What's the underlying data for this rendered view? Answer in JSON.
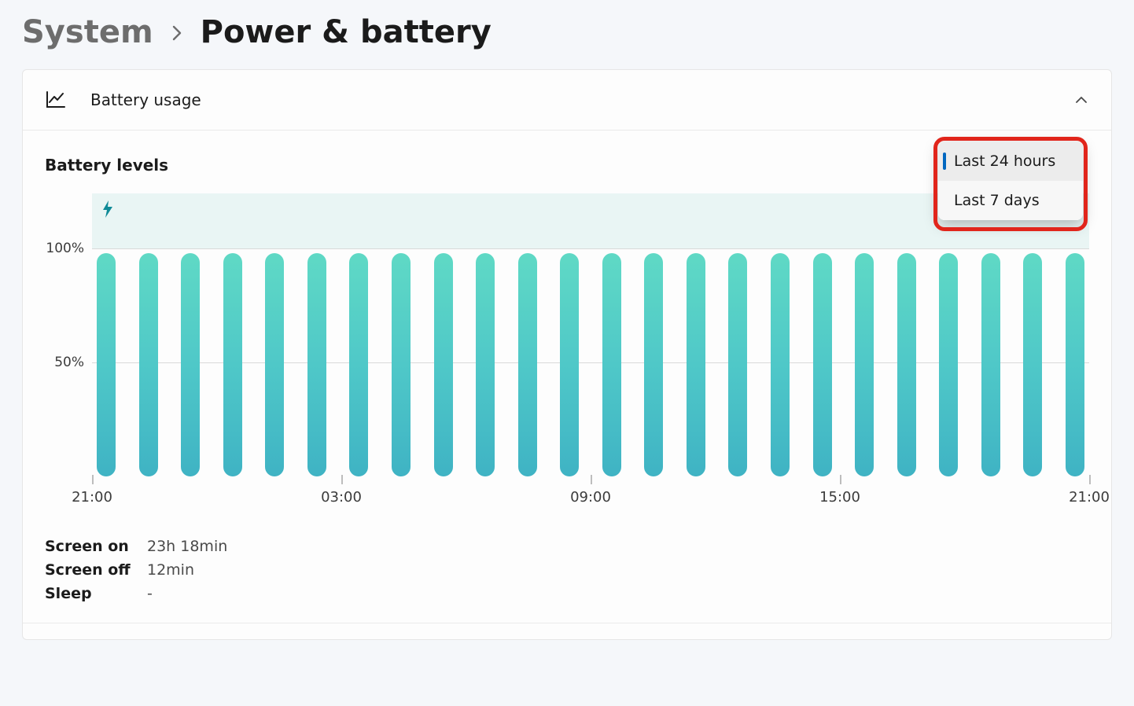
{
  "breadcrumb": {
    "parent": "System",
    "current": "Power & battery"
  },
  "card": {
    "header_title": "Battery usage",
    "section_title": "Battery levels"
  },
  "dropdown": {
    "options": [
      {
        "label": "Last 24 hours",
        "selected": true
      },
      {
        "label": "Last 7 days",
        "selected": false
      }
    ]
  },
  "summary": {
    "rows": [
      {
        "label": "Screen on",
        "value": "23h 18min"
      },
      {
        "label": "Screen off",
        "value": "12min"
      },
      {
        "label": "Sleep",
        "value": "-"
      }
    ]
  },
  "chart_data": {
    "type": "bar",
    "title": "Battery levels",
    "ylabel": "",
    "xlabel": "",
    "ylim": [
      0,
      100
    ],
    "y_ticks": [
      "100%",
      "50%"
    ],
    "x_ticks": [
      "21:00",
      "03:00",
      "09:00",
      "15:00",
      "21:00"
    ],
    "categories": [
      "21:00",
      "22:00",
      "23:00",
      "00:00",
      "01:00",
      "02:00",
      "03:00",
      "04:00",
      "05:00",
      "06:00",
      "07:00",
      "08:00",
      "09:00",
      "10:00",
      "11:00",
      "12:00",
      "13:00",
      "14:00",
      "15:00",
      "16:00",
      "17:00",
      "18:00",
      "19:00",
      "20:00"
    ],
    "values": [
      98,
      98,
      98,
      98,
      98,
      98,
      98,
      98,
      98,
      98,
      98,
      98,
      98,
      98,
      98,
      98,
      98,
      98,
      98,
      98,
      98,
      98,
      98,
      98
    ],
    "charging_indicator": true
  }
}
